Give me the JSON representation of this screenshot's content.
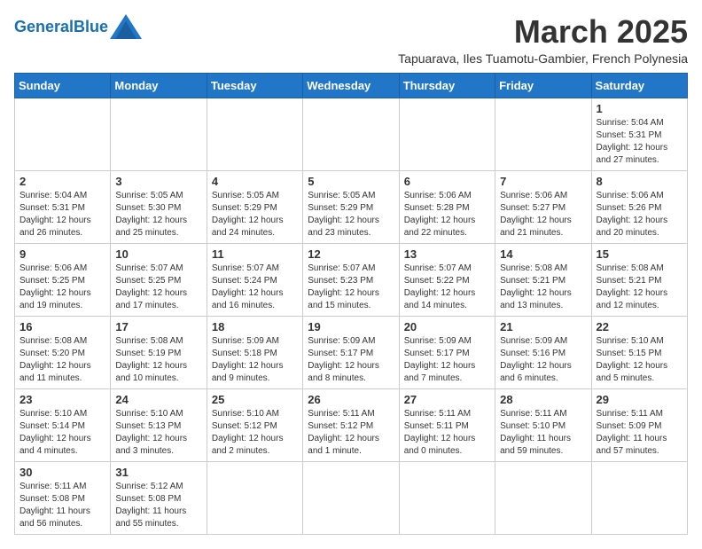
{
  "logo": {
    "text_general": "General",
    "text_blue": "Blue"
  },
  "title": "March 2025",
  "subtitle": "Tapuarava, Iles Tuamotu-Gambier, French Polynesia",
  "days_of_week": [
    "Sunday",
    "Monday",
    "Tuesday",
    "Wednesday",
    "Thursday",
    "Friday",
    "Saturday"
  ],
  "weeks": [
    [
      {
        "day": null,
        "info": null
      },
      {
        "day": null,
        "info": null
      },
      {
        "day": null,
        "info": null
      },
      {
        "day": null,
        "info": null
      },
      {
        "day": null,
        "info": null
      },
      {
        "day": null,
        "info": null
      },
      {
        "day": "1",
        "info": "Sunrise: 5:04 AM\nSunset: 5:31 PM\nDaylight: 12 hours and 27 minutes."
      }
    ],
    [
      {
        "day": "2",
        "info": "Sunrise: 5:04 AM\nSunset: 5:31 PM\nDaylight: 12 hours and 26 minutes."
      },
      {
        "day": "3",
        "info": "Sunrise: 5:05 AM\nSunset: 5:30 PM\nDaylight: 12 hours and 25 minutes."
      },
      {
        "day": "4",
        "info": "Sunrise: 5:05 AM\nSunset: 5:29 PM\nDaylight: 12 hours and 24 minutes."
      },
      {
        "day": "5",
        "info": "Sunrise: 5:05 AM\nSunset: 5:29 PM\nDaylight: 12 hours and 23 minutes."
      },
      {
        "day": "6",
        "info": "Sunrise: 5:06 AM\nSunset: 5:28 PM\nDaylight: 12 hours and 22 minutes."
      },
      {
        "day": "7",
        "info": "Sunrise: 5:06 AM\nSunset: 5:27 PM\nDaylight: 12 hours and 21 minutes."
      },
      {
        "day": "8",
        "info": "Sunrise: 5:06 AM\nSunset: 5:26 PM\nDaylight: 12 hours and 20 minutes."
      }
    ],
    [
      {
        "day": "9",
        "info": "Sunrise: 5:06 AM\nSunset: 5:25 PM\nDaylight: 12 hours and 19 minutes."
      },
      {
        "day": "10",
        "info": "Sunrise: 5:07 AM\nSunset: 5:25 PM\nDaylight: 12 hours and 17 minutes."
      },
      {
        "day": "11",
        "info": "Sunrise: 5:07 AM\nSunset: 5:24 PM\nDaylight: 12 hours and 16 minutes."
      },
      {
        "day": "12",
        "info": "Sunrise: 5:07 AM\nSunset: 5:23 PM\nDaylight: 12 hours and 15 minutes."
      },
      {
        "day": "13",
        "info": "Sunrise: 5:07 AM\nSunset: 5:22 PM\nDaylight: 12 hours and 14 minutes."
      },
      {
        "day": "14",
        "info": "Sunrise: 5:08 AM\nSunset: 5:21 PM\nDaylight: 12 hours and 13 minutes."
      },
      {
        "day": "15",
        "info": "Sunrise: 5:08 AM\nSunset: 5:21 PM\nDaylight: 12 hours and 12 minutes."
      }
    ],
    [
      {
        "day": "16",
        "info": "Sunrise: 5:08 AM\nSunset: 5:20 PM\nDaylight: 12 hours and 11 minutes."
      },
      {
        "day": "17",
        "info": "Sunrise: 5:08 AM\nSunset: 5:19 PM\nDaylight: 12 hours and 10 minutes."
      },
      {
        "day": "18",
        "info": "Sunrise: 5:09 AM\nSunset: 5:18 PM\nDaylight: 12 hours and 9 minutes."
      },
      {
        "day": "19",
        "info": "Sunrise: 5:09 AM\nSunset: 5:17 PM\nDaylight: 12 hours and 8 minutes."
      },
      {
        "day": "20",
        "info": "Sunrise: 5:09 AM\nSunset: 5:17 PM\nDaylight: 12 hours and 7 minutes."
      },
      {
        "day": "21",
        "info": "Sunrise: 5:09 AM\nSunset: 5:16 PM\nDaylight: 12 hours and 6 minutes."
      },
      {
        "day": "22",
        "info": "Sunrise: 5:10 AM\nSunset: 5:15 PM\nDaylight: 12 hours and 5 minutes."
      }
    ],
    [
      {
        "day": "23",
        "info": "Sunrise: 5:10 AM\nSunset: 5:14 PM\nDaylight: 12 hours and 4 minutes."
      },
      {
        "day": "24",
        "info": "Sunrise: 5:10 AM\nSunset: 5:13 PM\nDaylight: 12 hours and 3 minutes."
      },
      {
        "day": "25",
        "info": "Sunrise: 5:10 AM\nSunset: 5:12 PM\nDaylight: 12 hours and 2 minutes."
      },
      {
        "day": "26",
        "info": "Sunrise: 5:11 AM\nSunset: 5:12 PM\nDaylight: 12 hours and 1 minute."
      },
      {
        "day": "27",
        "info": "Sunrise: 5:11 AM\nSunset: 5:11 PM\nDaylight: 12 hours and 0 minutes."
      },
      {
        "day": "28",
        "info": "Sunrise: 5:11 AM\nSunset: 5:10 PM\nDaylight: 11 hours and 59 minutes."
      },
      {
        "day": "29",
        "info": "Sunrise: 5:11 AM\nSunset: 5:09 PM\nDaylight: 11 hours and 57 minutes."
      }
    ],
    [
      {
        "day": "30",
        "info": "Sunrise: 5:11 AM\nSunset: 5:08 PM\nDaylight: 11 hours and 56 minutes."
      },
      {
        "day": "31",
        "info": "Sunrise: 5:12 AM\nSunset: 5:08 PM\nDaylight: 11 hours and 55 minutes."
      },
      {
        "day": null,
        "info": null
      },
      {
        "day": null,
        "info": null
      },
      {
        "day": null,
        "info": null
      },
      {
        "day": null,
        "info": null
      },
      {
        "day": null,
        "info": null
      }
    ]
  ]
}
